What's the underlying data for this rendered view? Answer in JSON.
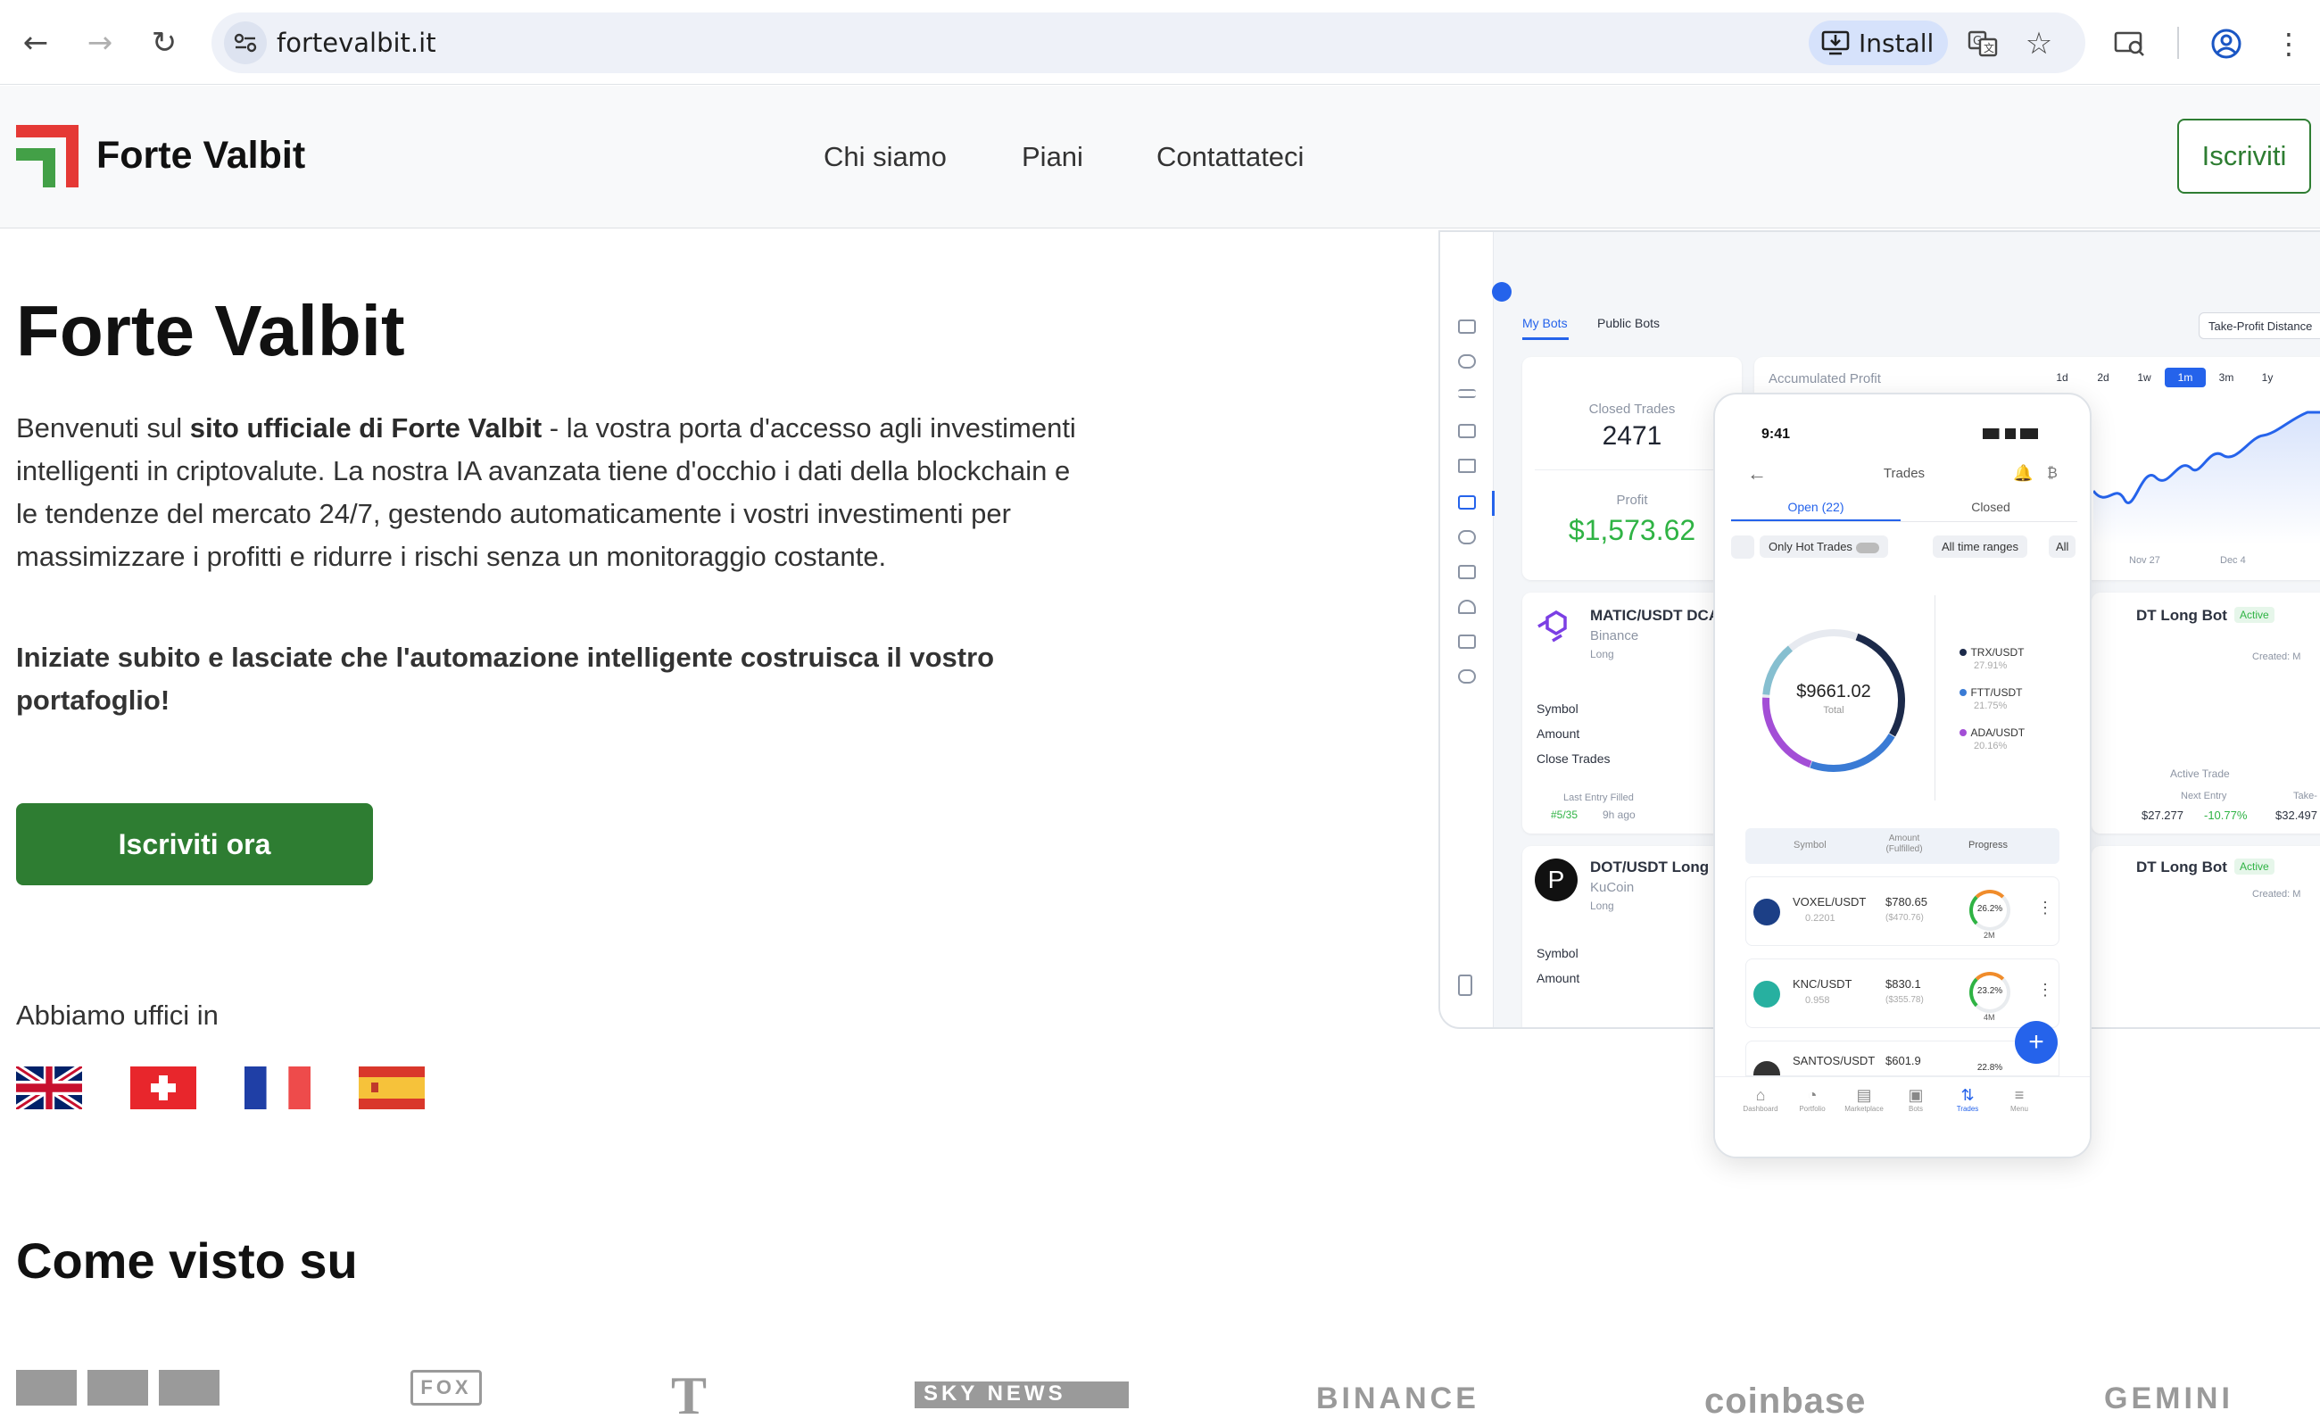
{
  "browser": {
    "url": "fortevalbit.it",
    "install_label": "Install"
  },
  "site": {
    "brand": "Forte Valbit",
    "nav": [
      "Chi siamo",
      "Piani",
      "Contattateci"
    ],
    "signup_label": "Iscriviti",
    "logo_colors": [
      "#e53935",
      "#43a047"
    ]
  },
  "hero": {
    "title": "Forte Valbit",
    "intro_pre": "Benvenuti sul ",
    "intro_bold": "sito ufficiale di Forte Valbit",
    "intro_post": " - la vostra porta d'accesso agli investimenti intelligenti in criptovalute. La nostra IA avanzata tiene d'occhio i dati della blockchain e le tendenze del mercato 24/7, gestendo automaticamente i vostri investimenti per massimizzare i profitti e ridurre i rischi senza un monitoraggio costante.",
    "cta_text": "Iniziate subito e lasciate che l'automazione intelligente costruisca il vostro portafoglio!",
    "cta_button": "Iscriviti ora",
    "offices_label": "Abbiamo uffici in",
    "offices_flags": [
      "uk-flag",
      "switzerland-flag",
      "france-flag",
      "spain-flag"
    ]
  },
  "press": {
    "title": "Come visto su",
    "logos": [
      "BBC",
      "FOX",
      "T",
      "SKY NEWS",
      "BINANCE",
      "coinbase",
      "GEMINI"
    ]
  },
  "dashboard": {
    "tabs": [
      "My Bots",
      "Public Bots"
    ],
    "takeprofit": "Take-Profit Distance",
    "closed_trades_label": "Closed Trades",
    "closed_trades_value": "2471",
    "profit_label": "Profit",
    "profit_value": "$1,573.62",
    "accum_label": "Accumulated Profit",
    "ranges": [
      "1d",
      "2d",
      "1w",
      "1m",
      "3m",
      "1y"
    ],
    "active_range": "1m",
    "x_labels": [
      "Nov 27",
      "Dec 4"
    ],
    "bot1": {
      "name": "MATIC/USDT DCA",
      "exchange": "Binance",
      "side": "Long"
    },
    "bot2": {
      "name": "DOT/USDT Long",
      "exchange": "KuCoin",
      "side": "Long"
    },
    "bot_rows": [
      "Symbol",
      "Amount",
      "Close Trades"
    ],
    "last_entry_label": "Last Entry Filled",
    "last_entry_value": "#5/35",
    "last_entry_time": "9h ago",
    "right_bot1": "DT Long Bot",
    "right_bot2": "DT Long Bot",
    "active_badge": "Active",
    "active_trade": "Active Trade",
    "next_entry_label": "Next Entry",
    "next_entry_value": "$27.277",
    "next_entry_change": "-10.77%",
    "take_label": "Take-",
    "take_value": "$32.497",
    "created_label": "Created: M"
  },
  "phone": {
    "time": "9:41",
    "title": "Trades",
    "tab_open": "Open (22)",
    "tab_closed": "Closed",
    "filter_hot": "Only Hot Trades",
    "filter_range": "All time ranges",
    "filter_all": "All",
    "total_value": "$9661.02",
    "total_label": "Total",
    "legend": [
      {
        "name": "TRX/USDT",
        "pct": "27.91%",
        "color": "#1c2a4a"
      },
      {
        "name": "FTT/USDT",
        "pct": "21.75%",
        "color": "#3a7bd5"
      },
      {
        "name": "ADA/USDT",
        "pct": "20.16%",
        "color": "#a34ed6"
      }
    ],
    "table_head": [
      "Symbol",
      "Amount (Fulfilled)",
      "Progress"
    ],
    "trades": [
      {
        "symbol": "VOXEL/USDT",
        "sub": "0.2201",
        "amount": "$780.65",
        "filled": "($470.76)",
        "progress": "26.2%",
        "period": "2M"
      },
      {
        "symbol": "KNC/USDT",
        "sub": "0.958",
        "amount": "$830.1",
        "filled": "($355.78)",
        "progress": "23.2%",
        "period": "4M"
      },
      {
        "symbol": "SANTOS/USDT",
        "sub": "",
        "amount": "$601.9",
        "filled": "",
        "progress": "22.8%",
        "period": ""
      }
    ],
    "bottom_nav": [
      "Dashboard",
      "Portfolio",
      "Marketplace",
      "Bots",
      "Trades",
      "Menu"
    ]
  }
}
